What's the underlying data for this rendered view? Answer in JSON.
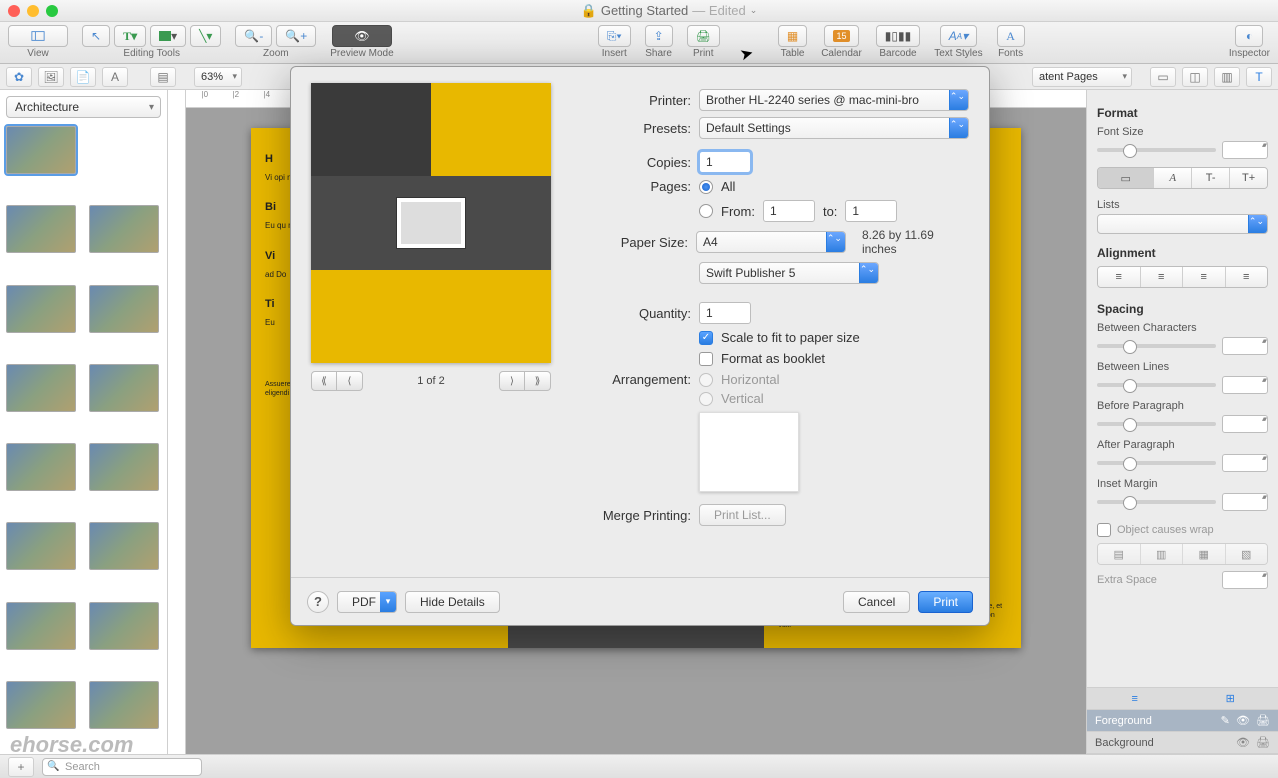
{
  "titlebar": {
    "doc_name": "Getting Started",
    "status": "— Edited",
    "lock_icon": "🔒"
  },
  "toolbar": {
    "view": "View",
    "editing_tools": "Editing Tools",
    "zoom": "Zoom",
    "preview_mode": "Preview Mode",
    "insert": "Insert",
    "share": "Share",
    "print": "Print",
    "table": "Table",
    "calendar": "Calendar",
    "barcode": "Barcode",
    "text_styles": "Text Styles",
    "fonts": "Fonts",
    "inspector": "Inspector"
  },
  "secbar": {
    "zoom_value": "63%",
    "content_pages": "atent Pages"
  },
  "left_panel": {
    "category": "Architecture",
    "search_placeholder": "Search"
  },
  "print_dialog": {
    "printer_label": "Printer:",
    "printer_value": "Brother HL-2240 series @ mac-mini-bro",
    "presets_label": "Presets:",
    "presets_value": "Default Settings",
    "copies_label": "Copies:",
    "copies_value": "1",
    "pages_label": "Pages:",
    "pages_all": "All",
    "pages_from": "From:",
    "pages_from_val": "1",
    "pages_to": "to:",
    "pages_to_val": "1",
    "paper_size_label": "Paper Size:",
    "paper_size_value": "A4",
    "paper_dim": "8.26 by 11.69 inches",
    "app_menu": "Swift Publisher 5",
    "quantity_label": "Quantity:",
    "quantity_value": "1",
    "scale_fit": "Scale to fit to paper size",
    "format_booklet": "Format as booklet",
    "arrangement_label": "Arrangement:",
    "arr_h": "Horizontal",
    "arr_v": "Vertical",
    "merge_label": "Merge Printing:",
    "merge_btn": "Print List...",
    "pager": "1 of 2",
    "help_label": "?",
    "pdf_btn": "PDF",
    "hide_details": "Hide Details",
    "cancel": "Cancel",
    "print_btn": "Print"
  },
  "inspector": {
    "format_h": "Format",
    "font_size": "Font Size",
    "lists": "Lists",
    "alignment": "Alignment",
    "spacing_h": "Spacing",
    "between_chars": "Between Characters",
    "between_lines": "Between Lines",
    "before_para": "Before Paragraph",
    "after_para": "After Paragraph",
    "inset_margin": "Inset Margin",
    "object_wrap": "Object causes wrap",
    "extra_space": "Extra Space",
    "foreground": "Foreground",
    "background": "Background"
  },
  "watermark": "ehorse.com"
}
